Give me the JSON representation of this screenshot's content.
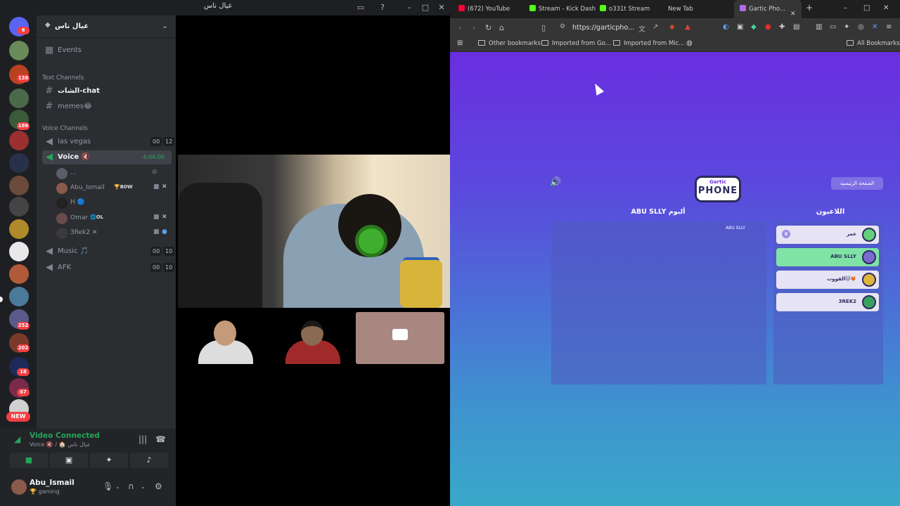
{
  "discord": {
    "window_title": "عيال ناس",
    "guild_name": "عيال ناس",
    "events_label": "Events",
    "categories": {
      "text": "Text Channels",
      "voice": "Voice Channels"
    },
    "text_channels": [
      "الشات-chat",
      "memes😂"
    ],
    "voice_channels": [
      {
        "name": "las vegas",
        "c1": "00",
        "c2": "12"
      },
      {
        "name": "Voice 🔇",
        "timer": "4:04:06"
      },
      {
        "name": "Music 🎵",
        "c1": "00",
        "c2": "10"
      },
      {
        "name": "AFK",
        "c1": "00",
        "c2": "10"
      }
    ],
    "voice_users": [
      {
        "name": "...",
        "tag": ""
      },
      {
        "name": "Abu_Ismail",
        "tag": "🏆B0W"
      },
      {
        "name": "H 🔵",
        "tag": ""
      },
      {
        "name": "Omar",
        "tag": "🌐OL"
      },
      {
        "name": "3Rek2 ✕",
        "tag": ""
      }
    ],
    "server_badges": [
      {
        "label": "6"
      },
      {
        "label": "138"
      },
      {
        "label": "186"
      },
      {
        "label": "252"
      },
      {
        "label": "202"
      },
      {
        "label": "18"
      },
      {
        "label": "67"
      }
    ],
    "server_new_label": "NEW",
    "voice_status": "Video Connected",
    "voice_sub": "Voice 🔇 / 🏠 عيال ناس",
    "user_name": "Abu_Ismail",
    "user_status": "🏆 gaming",
    "colors": {
      "green": "#23a55a",
      "badge": "#f23f43"
    }
  },
  "browser": {
    "tabs": [
      {
        "label": "(672) YouTube",
        "color": "#ff0033"
      },
      {
        "label": "Stream - Kick Dash",
        "color": "#53fc18"
      },
      {
        "label": "o331t Stream",
        "color": "#53fc18"
      },
      {
        "label": "New Tab",
        "color": ""
      },
      {
        "label": "Gartic Pho...",
        "color": "#b06ce8"
      }
    ],
    "url": "https://garticpho...",
    "bookmarks": [
      "Other bookmarks",
      "Imported from Go...",
      "Imported from Mic...",
      "All Bookmarks"
    ]
  },
  "game": {
    "logo_top": "Gartic",
    "logo_main": "PHONE",
    "home_button": "الصفحة الرئيسية",
    "album_title": "ABU SLLY ألبوم",
    "album_owner": "ABU SLLY",
    "players_title": "اللاعبون",
    "players": [
      {
        "name": "عمر",
        "host": true,
        "highlight": false,
        "avatar_color": "#63d07a"
      },
      {
        "name": "ABU SLLY",
        "host": false,
        "highlight": true,
        "avatar_color": "#7a6ad0"
      },
      {
        "name": "القووت🐱🦊",
        "host": false,
        "highlight": false,
        "avatar_color": "#e0b43a"
      },
      {
        "name": "3REK2",
        "host": false,
        "highlight": false,
        "avatar_color": "#3aa060"
      }
    ]
  }
}
